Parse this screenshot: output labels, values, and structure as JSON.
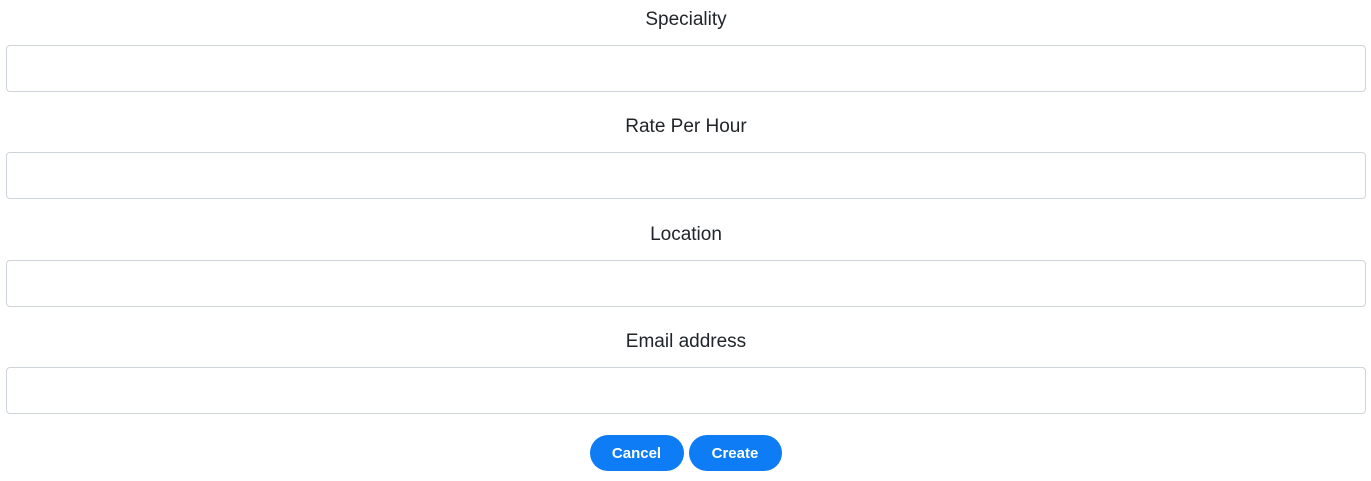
{
  "form": {
    "fields": [
      {
        "label": "Speciality",
        "value": "",
        "placeholder": ""
      },
      {
        "label": "Rate Per Hour",
        "value": "",
        "placeholder": ""
      },
      {
        "label": "Location",
        "value": "",
        "placeholder": ""
      },
      {
        "label": "Email address",
        "value": "",
        "placeholder": ""
      }
    ],
    "actions": {
      "cancel_label": "Cancel",
      "create_label": "Create"
    }
  },
  "colors": {
    "button_bg": "#0d7cf5",
    "button_text": "#ffffff",
    "input_border": "#ced4da",
    "label_text": "#212529"
  }
}
